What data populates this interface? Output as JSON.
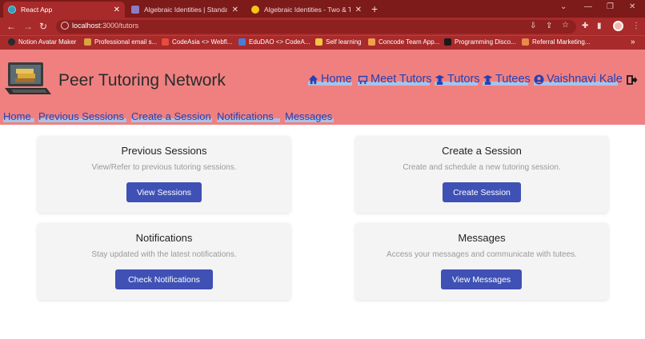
{
  "browser": {
    "tabs": [
      {
        "title": "React App",
        "active": true,
        "favicon_color": "#61dafb"
      },
      {
        "title": "Algebraic Identities | Standard Al",
        "active": false,
        "favicon_color": "#8e7cc3"
      },
      {
        "title": "Algebraic Identities - Two & Thre",
        "active": false,
        "favicon_color": "#f5c518"
      }
    ],
    "url_host": "localhost",
    "url_path": ":3000/tutors",
    "bookmarks": [
      "Notion Avatar Maker",
      "Professional email s...",
      "CodeAsia <> Webfl...",
      "EduDAO <> CodeA...",
      "Self learning",
      "Concode Team App...",
      "Programming Disco...",
      "Referral Marketing..."
    ],
    "more": "»"
  },
  "header": {
    "brand": "Peer Tutoring Network",
    "nav": {
      "home": "Home",
      "meet_tutors": "Meet Tutors",
      "tutors": "Tutors",
      "tutees": "Tutees",
      "user": "Vaishnavi Kale"
    },
    "subnav": {
      "home": "Home",
      "previous_sessions": "Previous Sessions",
      "create_session": "Create a Session",
      "notifications": "Notifications",
      "messages": "Messages"
    }
  },
  "cards": {
    "previous": {
      "title": "Previous Sessions",
      "desc": "View/Refer to previous tutoring sessions.",
      "button": "View Sessions"
    },
    "create": {
      "title": "Create a Session",
      "desc": "Create and schedule a new tutoring session.",
      "button": "Create Session"
    },
    "notifications": {
      "title": "Notifications",
      "desc": "Stay updated with the latest notifications.",
      "button": "Check Notifications"
    },
    "messages": {
      "title": "Messages",
      "desc": "Access your messages and communicate with tutees.",
      "button": "View Messages"
    }
  },
  "colors": {
    "header_bg": "#f08080",
    "link": "#2541b2",
    "button": "#3f51b5",
    "browser_frame": "#a82a2a"
  }
}
